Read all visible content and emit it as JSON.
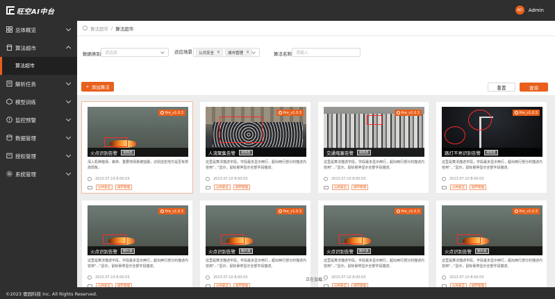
{
  "app": {
    "title": "旺空AI中台"
  },
  "user": {
    "initials": "AD",
    "name": "Admin"
  },
  "sidebar": {
    "items": [
      {
        "label": "总体概览",
        "icon": "dashboard-icon"
      },
      {
        "label": "算法超市",
        "icon": "store-icon",
        "expanded": true
      },
      {
        "label": "解析任务",
        "icon": "task-icon"
      },
      {
        "label": "模型训练",
        "icon": "model-icon"
      },
      {
        "label": "监控预警",
        "icon": "alert-icon"
      },
      {
        "label": "数据管理",
        "icon": "database-icon"
      },
      {
        "label": "授权管理",
        "icon": "license-icon"
      },
      {
        "label": "系统管理",
        "icon": "settings-icon"
      }
    ],
    "subitem": "算法超市"
  },
  "breadcrumb": {
    "root": "算法超市",
    "sep": "/",
    "current": "算法超市"
  },
  "filters": {
    "category_label": "数据类别",
    "category_placeholder": "请选择",
    "scene_label": "适应场景",
    "scene_tags": [
      "公共安全",
      "城市管理"
    ],
    "name_label": "算法名称",
    "name_placeholder": "请输入",
    "add_button": "添加算法",
    "reset_button": "重置",
    "search_button": "查询"
  },
  "colors": {
    "accent": "#e8601c",
    "sidebar": "#2f2f2f",
    "detection": "#ff2a2a"
  },
  "cards": [
    {
      "title": "火点识别告警",
      "badge": "视频类",
      "version": "fire_v1.0.3",
      "desc": "深入机种植场、森林、重要地场景被拍摄，识别这些地方是否有燃烧现象。",
      "date": "2023.07.10 8:00:03",
      "tags": [
        "公共安全",
        "城市管理"
      ],
      "scene": "fire"
    },
    {
      "title": "人流聚集告警",
      "badge": "视频类",
      "version": "fire_v1.0.3",
      "desc": "这里是算法描述字段，字段最多显示两行，超出两行部分的描述内容用\"...\"显示，鼠标悬停显示全部字段描述。",
      "date": "2023.07.10 8:00:03",
      "tags": [
        "公共安全",
        "城市管理"
      ],
      "scene": "crowd"
    },
    {
      "title": "交通堵塞告警",
      "badge": "视频类",
      "version": "fire_v1.0.3",
      "desc": "这里是算法描述字段，字段最多显示两行，超出两行部分的描述内容用\"...\"显示，鼠标悬停显示全部字段描述。",
      "date": "2023.07.10 8:00:03",
      "tags": [
        "公共安全",
        "城市管理"
      ],
      "scene": "traffic"
    },
    {
      "title": "路灯不亮识别告警",
      "badge": "视频类",
      "version": "fire_v1.0.3",
      "desc": "这里是算法描述字段，字段最多显示两行，超出两行部分的描述内容用\"...\"显示，鼠标悬停显示全部字段描述。",
      "date": "2023.07.10 8:00:03",
      "tags": [
        "公共安全",
        "城市管理"
      ],
      "scene": "lamp"
    },
    {
      "title": "火点识别告警",
      "badge": "图片类",
      "version": "fire_v1.0.3",
      "desc": "这里是算法描述字段，字段最多显示两行，超出两行部分的描述内容用\"...\"显示，鼠标悬停显示全部字段描述。",
      "date": "2023.07.10 8:00:03",
      "tags": [
        "公共安全",
        "城市管理"
      ],
      "scene": "fire"
    },
    {
      "title": "火点识别告警",
      "badge": "图片类",
      "version": "fire_v1.0.3",
      "desc": "这里是算法描述字段，字段最多显示两行，超出两行部分的描述内容用\"...\"显示，鼠标悬停显示全部字段描述。",
      "date": "2023.07.10 8:00:03",
      "tags": [
        "公共安全",
        "城市管理"
      ],
      "scene": "fire"
    },
    {
      "title": "火点识别告警",
      "badge": "图片类",
      "version": "fire_v1.0.3",
      "desc": "这里是算法描述字段，字段最多显示两行，超出两行部分的描述内容用\"...\"显示，鼠标悬停显示全部字段描述。",
      "date": "2023.07.10 8:00:03",
      "tags": [
        "公共安全",
        "城市管理"
      ],
      "scene": "fire"
    },
    {
      "title": "火点识别告警",
      "badge": "图片类",
      "version": "fire_v1.0.3",
      "desc": "这里是算法描述字段，字段最多显示两行，超出两行部分的描述内容用\"...\"显示，鼠标悬停显示全部字段描述。",
      "date": "2023.07.10 8:00:03",
      "tags": [
        "公共安全",
        "城市管理"
      ],
      "scene": "fire"
    }
  ],
  "loading": "正在加载...",
  "footer": "©2023 壹园科技 Inc. All Rights Reserved."
}
